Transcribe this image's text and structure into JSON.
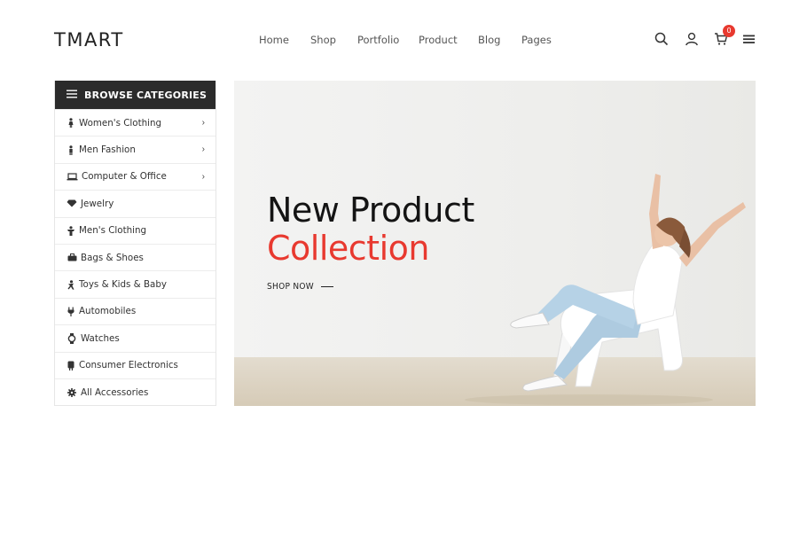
{
  "brand": {
    "logo": "TMART"
  },
  "nav": [
    {
      "label": "Home"
    },
    {
      "label": "Shop"
    },
    {
      "label": "Portfolio"
    },
    {
      "label": "Product"
    },
    {
      "label": "Blog"
    },
    {
      "label": "Pages"
    }
  ],
  "header_icons": {
    "search": "search-icon",
    "account": "user-icon",
    "cart": "cart-icon",
    "menu": "hamburger-menu-icon",
    "cart_count": "0"
  },
  "sidebar": {
    "title": "BROWSE CATEGORIES",
    "items": [
      {
        "label": "Women's Clothing",
        "icon": "woman-icon",
        "has_submenu": true
      },
      {
        "label": "Men Fashion",
        "icon": "man-icon",
        "has_submenu": true
      },
      {
        "label": "Computer & Office",
        "icon": "laptop-icon",
        "has_submenu": true
      },
      {
        "label": "Jewelry",
        "icon": "diamond-icon",
        "has_submenu": false
      },
      {
        "label": "Men's Clothing",
        "icon": "shirt-icon",
        "has_submenu": false
      },
      {
        "label": "Bags & Shoes",
        "icon": "bag-icon",
        "has_submenu": false
      },
      {
        "label": "Toys & Kids & Baby",
        "icon": "child-icon",
        "has_submenu": false
      },
      {
        "label": "Automobiles",
        "icon": "car-icon",
        "has_submenu": false
      },
      {
        "label": "Watches",
        "icon": "watch-icon",
        "has_submenu": false
      },
      {
        "label": "Consumer Electronics",
        "icon": "electronics-icon",
        "has_submenu": false
      },
      {
        "label": "All Accessories",
        "icon": "gear-icon",
        "has_submenu": false
      }
    ]
  },
  "hero": {
    "title_line1": "New Product",
    "title_line2": "Collection",
    "cta": "SHOP NOW"
  },
  "colors": {
    "accent": "#e8392f",
    "sidebar_header": "#2b2b2b",
    "text_dark": "#141414"
  }
}
